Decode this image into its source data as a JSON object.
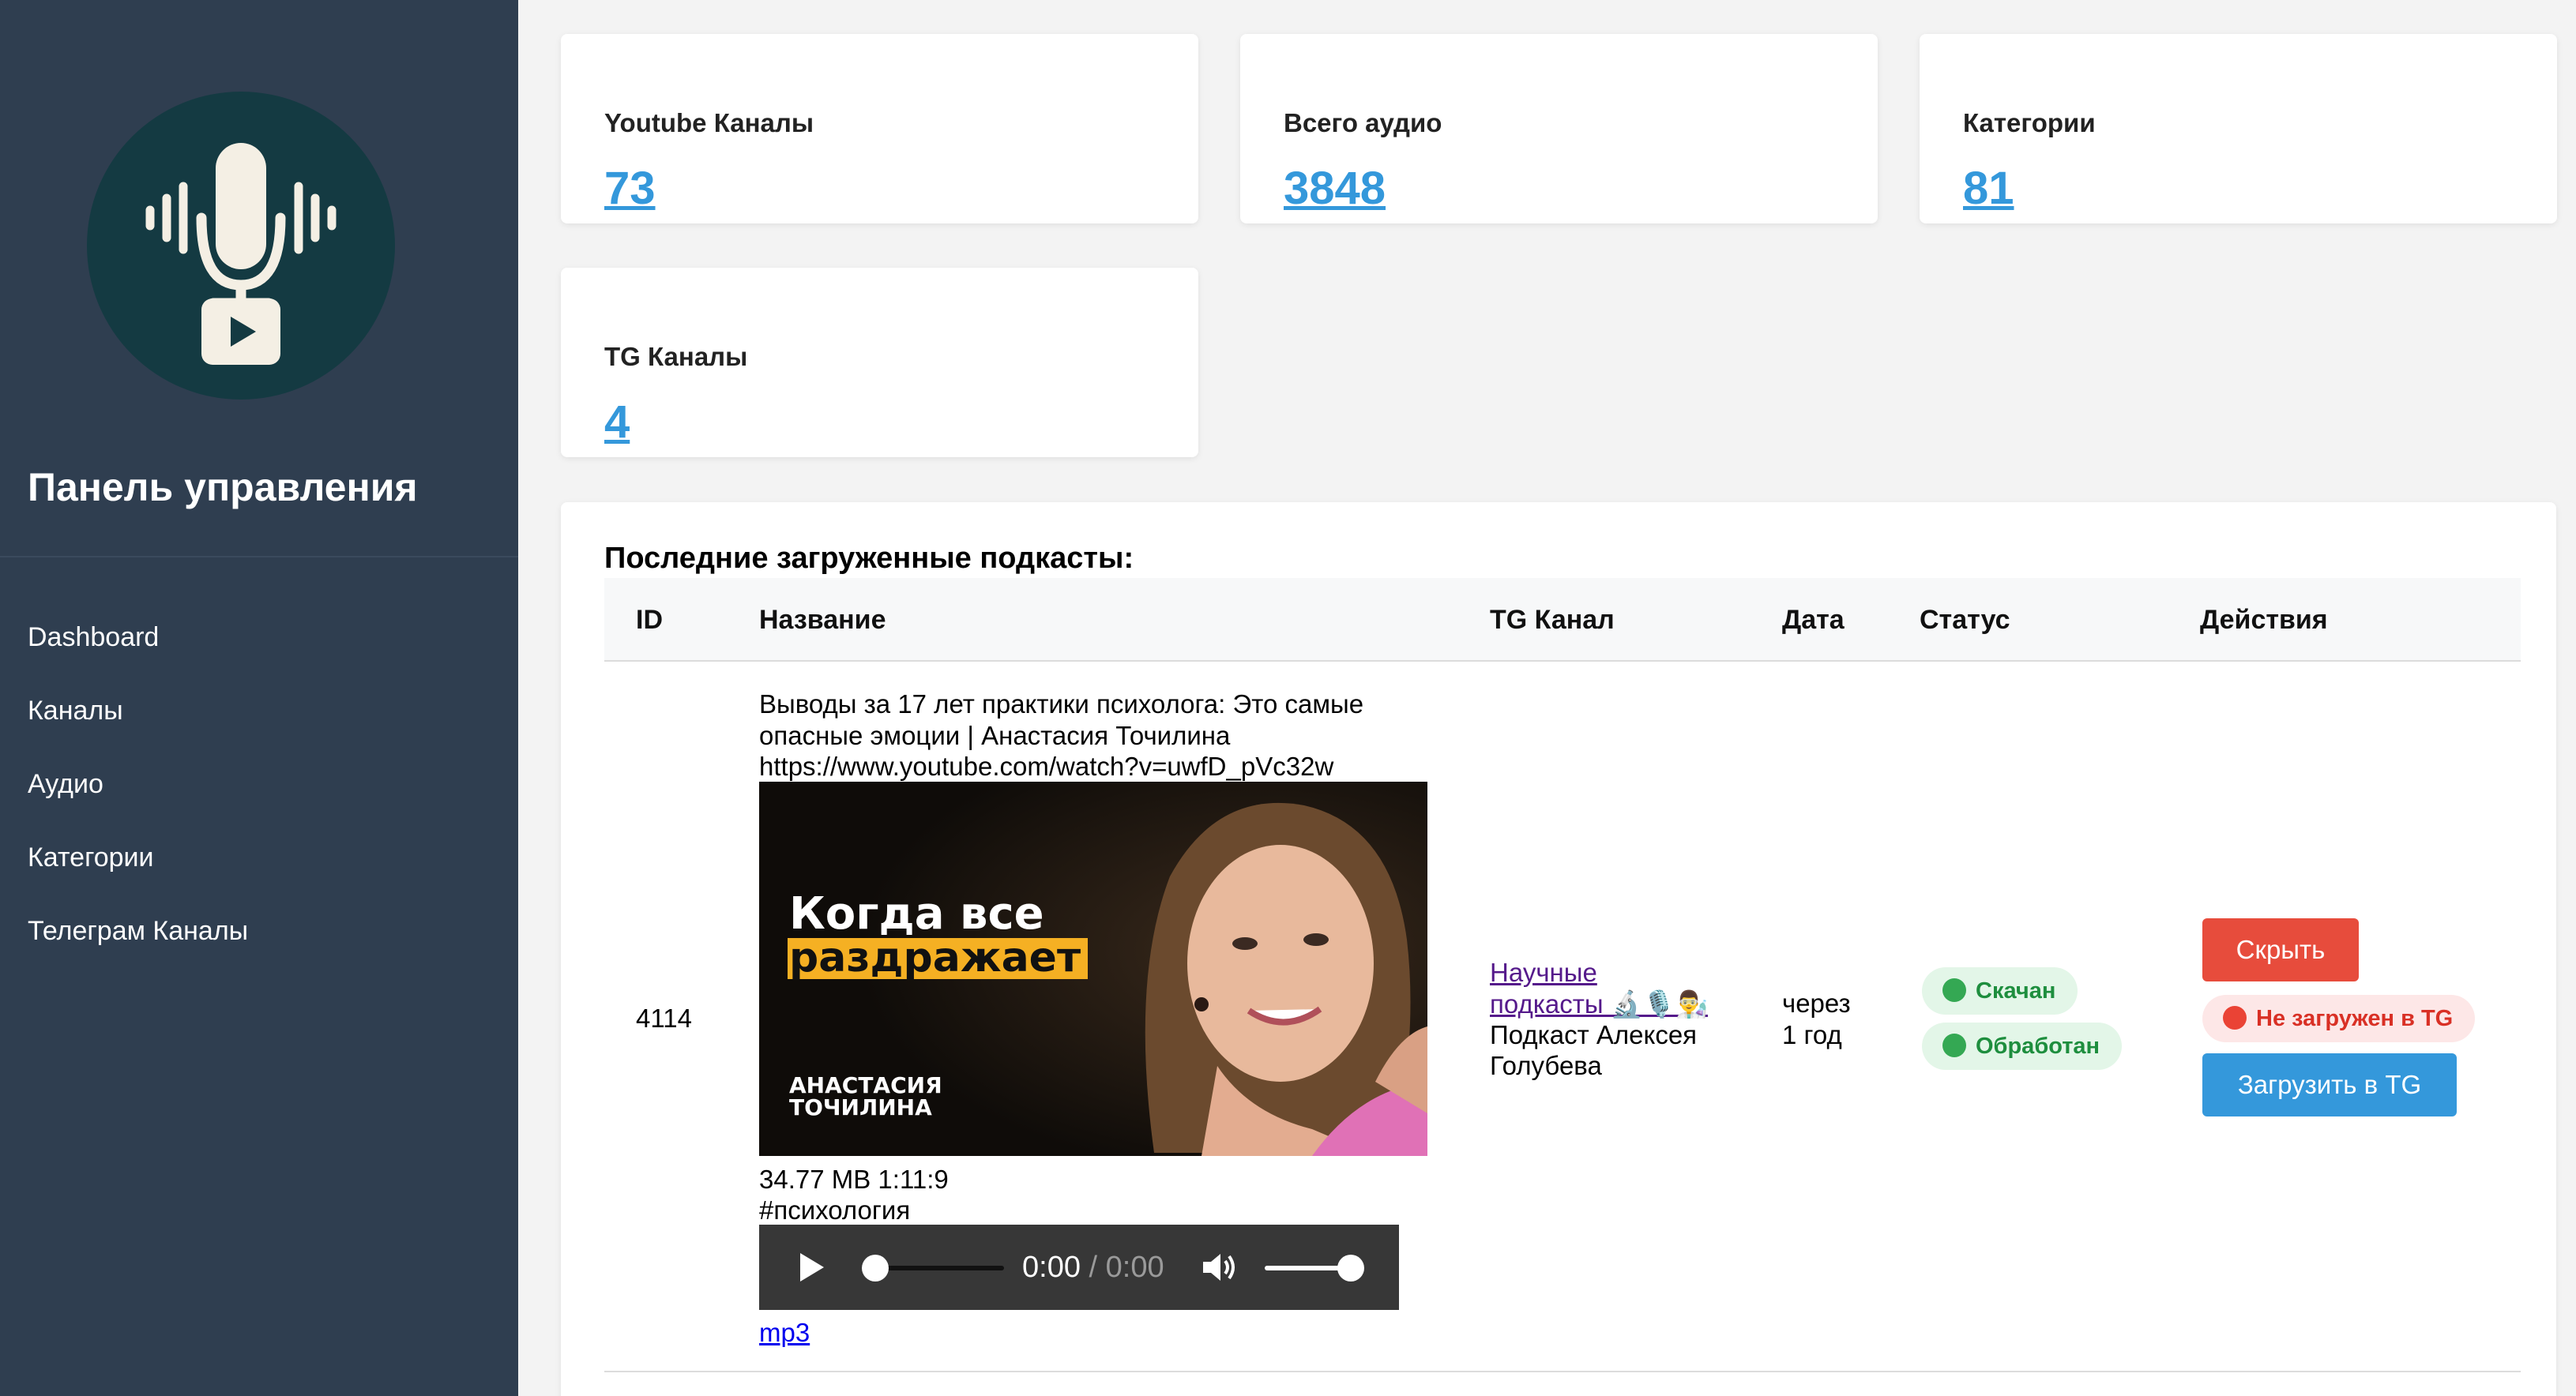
{
  "sidebar": {
    "title": "Панель управления",
    "nav": [
      "Dashboard",
      "Каналы",
      "Аудио",
      "Категории",
      "Телеграм Каналы"
    ]
  },
  "stats": [
    {
      "label": "Youtube Каналы",
      "value": "73"
    },
    {
      "label": "Всего аудио",
      "value": "3848"
    },
    {
      "label": "Категории",
      "value": "81"
    },
    {
      "label": "TG Каналы",
      "value": "4"
    }
  ],
  "podcasts": {
    "title": "Последние загруженные подкасты:",
    "columns": [
      "ID",
      "Название",
      "TG Канал",
      "Дата",
      "Статус",
      "Действия"
    ],
    "row": {
      "id": "4114",
      "title_line1": "Выводы за 17 лет практики психолога: Это самые",
      "title_line2": "опасные эмоции | Анастасия Точилина",
      "url": "https://www.youtube.com/watch?v=uwfD_pVc32w",
      "thumb_line1": "Когда все",
      "thumb_line2": "раздражает",
      "thumb_name1": "АНАСТАСИЯ",
      "thumb_name2": "ТОЧИЛИНА",
      "meta": "34.77 MB 1:11:9",
      "tag": "#психология",
      "audio_current": "0:00",
      "audio_duration": "0:00",
      "file_link": "mp3",
      "tg_link_line1": "Научные",
      "tg_link_line2": "подкасты 🔬🎙️👨‍🔬",
      "tg_sub_line1": "Подкаст Алексея",
      "tg_sub_line2": "Голубева",
      "date_line1": "через",
      "date_line2": "1 год",
      "status_downloaded": "Скачан",
      "status_processed": "Обработан",
      "btn_hide": "Скрыть",
      "status_tg": "Не загружен в TG",
      "btn_upload": "Загрузить в TG"
    }
  },
  "colors": {
    "sidebar_bg": "#2f3e50",
    "accent": "#3498db",
    "danger": "#e74c3c",
    "success": "#34a853"
  }
}
